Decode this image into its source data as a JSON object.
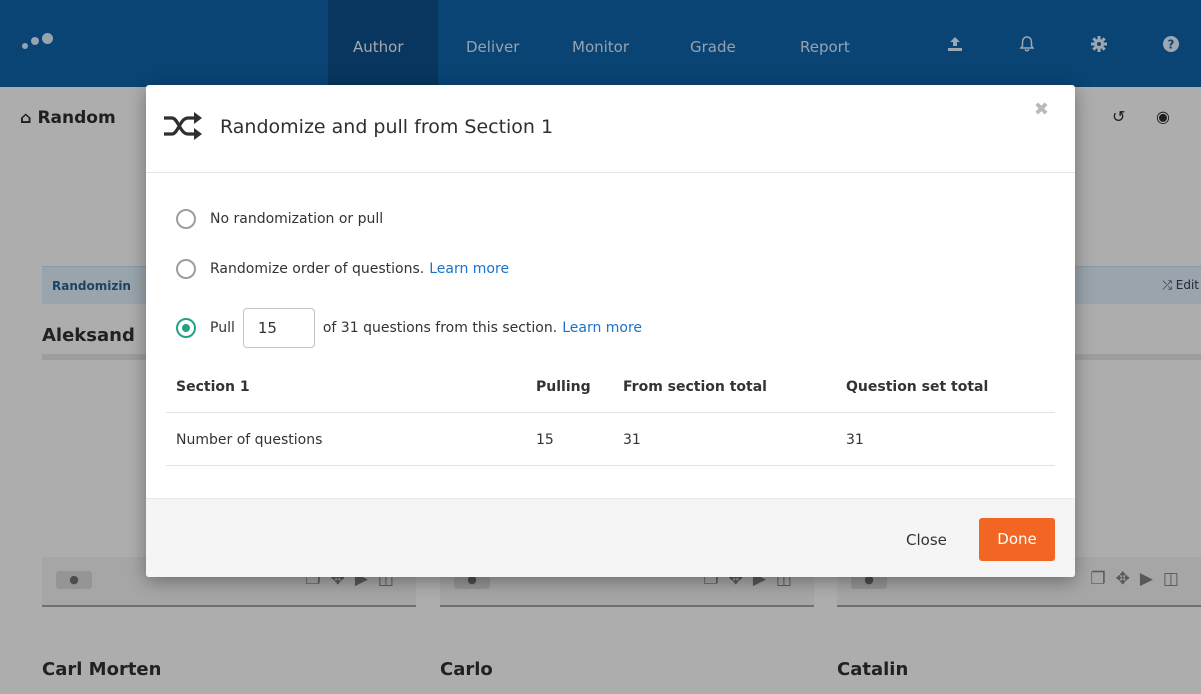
{
  "nav": {
    "items": [
      "Author",
      "Deliver",
      "Monitor",
      "Grade",
      "Report"
    ],
    "active": "Author",
    "icons": [
      "upload-icon",
      "bell-icon",
      "gear-icon",
      "help-icon"
    ]
  },
  "page": {
    "breadcrumb": "Random",
    "strip_label": "Randomizin",
    "strip_edit": "Edit",
    "people": [
      "Aleksand",
      "Carl Morten",
      "Carlo",
      "Catalin"
    ]
  },
  "modal": {
    "title": "Randomize and pull from Section 1",
    "options": {
      "none": "No randomization or pull",
      "order": "Randomize order of questions.",
      "pull_prefix": "Pull",
      "pull_suffix": "of 31 questions from this section.",
      "learn_more": "Learn more"
    },
    "pull_value": "15",
    "selected_option": "pull",
    "table": {
      "headers": [
        "Section 1",
        "Pulling",
        "From section total",
        "Question set total"
      ],
      "row": [
        "Number of questions",
        "15",
        "31",
        "31"
      ]
    },
    "footer": {
      "close_label": "Close",
      "done_label": "Done"
    }
  },
  "colors": {
    "nav_bg": "#0f5fa1",
    "accent_green": "#22a386",
    "done_orange": "#f26522",
    "link_blue": "#1a73c9"
  }
}
